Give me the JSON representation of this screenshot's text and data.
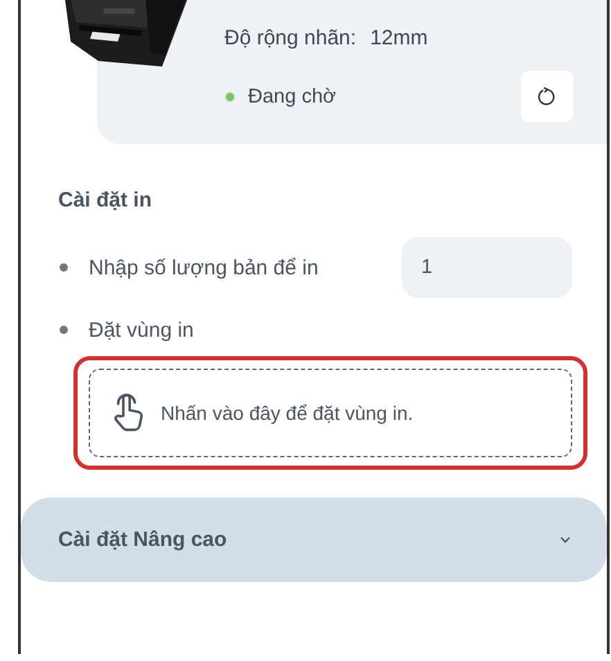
{
  "printer_info": {
    "label_width_label": "Độ rộng nhãn:",
    "label_width_value": "12mm",
    "status": "Đang chờ"
  },
  "print_settings": {
    "title": "Cài đặt in",
    "items": [
      {
        "kind": "number",
        "label": "Nhập số lượng bản để in",
        "value": "1"
      },
      {
        "kind": "area",
        "label": "Đặt vùng in",
        "prompt": "Nhấn vào đây để đặt vùng in.",
        "highlighted": true
      }
    ]
  },
  "advanced": {
    "title": "Cài đặt Nâng cao",
    "expanded": false
  }
}
